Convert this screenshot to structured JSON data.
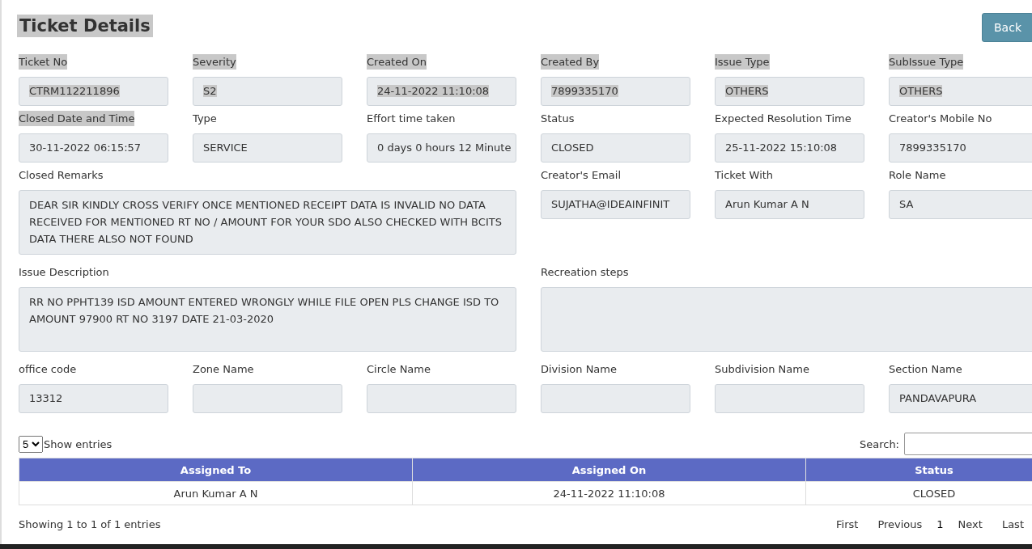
{
  "title": {
    "text": "Ticket Details",
    "highlighted": true
  },
  "back_button": "Back",
  "form_rows": [
    [
      {
        "kind": "input",
        "label": "Ticket No",
        "value": "CTRM112211896",
        "label_highlighted": true,
        "value_highlighted": true
      },
      {
        "kind": "input",
        "label": "Severity",
        "value": "S2",
        "label_highlighted": true,
        "value_highlighted": true
      },
      {
        "kind": "input",
        "label": "Created On",
        "value": "24-11-2022 11:10:08",
        "label_highlighted": true,
        "value_highlighted": true
      },
      {
        "kind": "input",
        "label": "Created By",
        "value": "7899335170",
        "label_highlighted": true,
        "value_highlighted": true
      },
      {
        "kind": "input",
        "label": "Issue Type",
        "value": "OTHERS",
        "label_highlighted": true,
        "value_highlighted": true
      },
      {
        "kind": "input",
        "label": "SubIssue Type",
        "value": "OTHERS",
        "label_highlighted": true,
        "value_highlighted": true
      }
    ],
    [
      {
        "kind": "input",
        "label": "Closed Date and Time",
        "value": "30-11-2022 06:15:57",
        "label_highlighted": true,
        "value_highlighted": false
      },
      {
        "kind": "input",
        "label": "Type",
        "value": "SERVICE",
        "label_highlighted": false,
        "value_highlighted": false
      },
      {
        "kind": "input",
        "label": "Effort time taken",
        "value": "0 days 0 hours 12 Minute",
        "label_highlighted": false,
        "value_highlighted": false
      },
      {
        "kind": "input",
        "label": "Status",
        "value": "CLOSED",
        "label_highlighted": false,
        "value_highlighted": false
      },
      {
        "kind": "input",
        "label": "Expected Resolution Time",
        "value": "25-11-2022 15:10:08",
        "label_highlighted": false,
        "value_highlighted": false
      },
      {
        "kind": "input",
        "label": "Creator's Mobile No",
        "value": "7899335170",
        "label_highlighted": false,
        "value_highlighted": false
      }
    ],
    [
      {
        "kind": "textarea",
        "label": "Closed Remarks",
        "value": "DEAR SIR KINDLY CROSS VERIFY ONCE MENTIONED RECEIPT DATA IS INVALID NO DATA RECEIVED FOR MENTIONED RT NO / AMOUNT FOR YOUR SDO ALSO CHECKED WITH BCITS DATA THERE ALSO NOT FOUND",
        "label_highlighted": false,
        "value_highlighted": false
      },
      {
        "kind": "input",
        "label": "Creator's Email",
        "value": "SUJATHA@IDEAINFINIT",
        "label_highlighted": false,
        "value_highlighted": false
      },
      {
        "kind": "input",
        "label": "Ticket With",
        "value": "Arun Kumar A N",
        "label_highlighted": false,
        "value_highlighted": false
      },
      {
        "kind": "input",
        "label": "Role Name",
        "value": "SA",
        "label_highlighted": false,
        "value_highlighted": false
      }
    ],
    [
      {
        "kind": "textarea",
        "label": "Issue Description",
        "value": "RR NO PPHT139 ISD AMOUNT ENTERED WRONGLY WHILE FILE OPEN PLS CHANGE ISD TO AMOUNT 97900 RT NO 3197 DATE  21-03-2020",
        "label_highlighted": false,
        "value_highlighted": false
      },
      {
        "kind": "textarea",
        "label": "Recreation steps",
        "label_highlighted": false
      }
    ],
    [
      {
        "kind": "input",
        "label": "office code",
        "value": "13312",
        "label_highlighted": false,
        "value_highlighted": false
      },
      {
        "kind": "input",
        "label": "Zone Name",
        "label_highlighted": false
      },
      {
        "kind": "input",
        "label": "Circle Name",
        "label_highlighted": false
      },
      {
        "kind": "input",
        "label": "Division Name",
        "label_highlighted": false
      },
      {
        "kind": "input",
        "label": "Subdivision Name",
        "label_highlighted": false
      },
      {
        "kind": "input",
        "label": "Section Name",
        "value": "PANDAVAPURA",
        "label_highlighted": false,
        "value_highlighted": false
      }
    ]
  ],
  "table": {
    "page_size": "5",
    "show_entries_label": "Show entries",
    "search_label": "Search:",
    "columns": [
      "Assigned To",
      "Assigned On",
      "Status"
    ],
    "rows": [
      [
        "Arun Kumar A N",
        "24-11-2022 11:10:08",
        "CLOSED"
      ]
    ],
    "info": "Showing 1 to 1 of 1 entries",
    "pagination": [
      {
        "label": "First",
        "selected": false
      },
      {
        "label": "Previous",
        "selected": false
      },
      {
        "label": "1",
        "selected": true
      },
      {
        "label": "Next",
        "selected": false
      },
      {
        "label": "Last",
        "selected": false
      }
    ]
  }
}
